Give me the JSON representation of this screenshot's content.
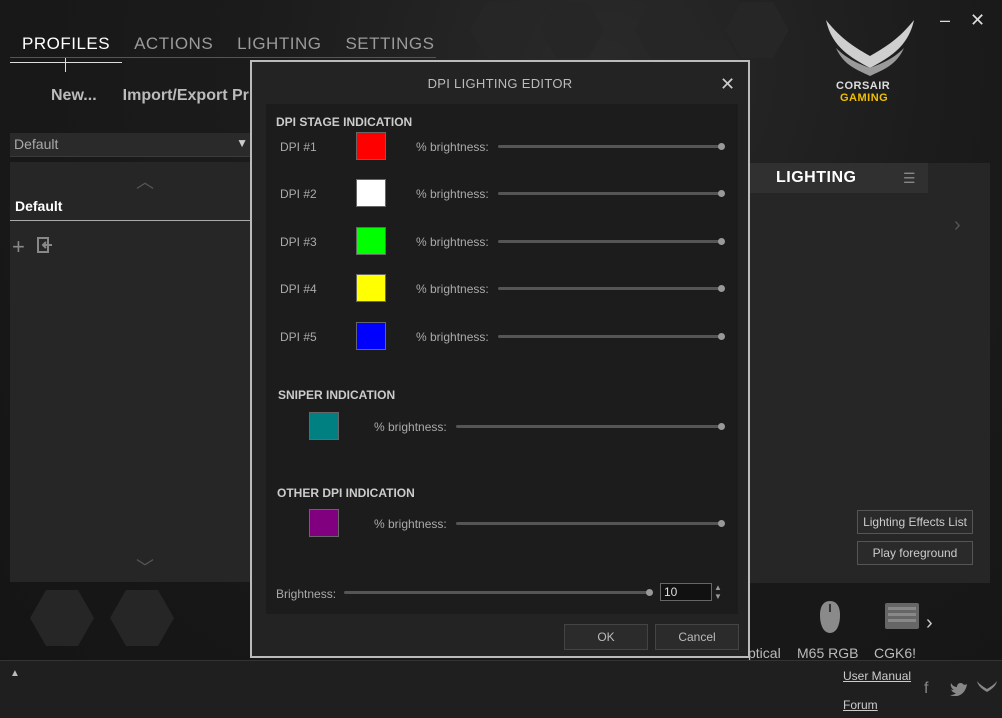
{
  "nav": {
    "tabs": [
      {
        "label": "PROFILES",
        "active": true
      },
      {
        "label": "ACTIONS",
        "active": false
      },
      {
        "label": "LIGHTING",
        "active": false
      },
      {
        "label": "SETTINGS",
        "active": false
      }
    ]
  },
  "window": {
    "minimize": "–",
    "close": "✕"
  },
  "logo": {
    "line1": "CORSAIR",
    "line2": "GAMING"
  },
  "profiles": {
    "new_label": "New...",
    "import_export_label": "Import/Export Pr",
    "selected": "Default",
    "items": [
      "Default"
    ]
  },
  "right_panel": {
    "tab_label": "LIGHTING",
    "effects_list_label": "Lighting Effects List",
    "play_label": "Play foreground"
  },
  "devices": [
    "ptical",
    "M65 RGB",
    "CGK6!"
  ],
  "bottom": {
    "user_manual": "User Manual",
    "forum": "Forum"
  },
  "dialog": {
    "title": "DPI LIGHTING EDITOR",
    "stage_section": "DPI STAGE INDICATION",
    "brightness_label": "% brightness:",
    "stages": [
      {
        "label": "DPI #1",
        "color": "#ff0000"
      },
      {
        "label": "DPI #2",
        "color": "#ffffff"
      },
      {
        "label": "DPI #3",
        "color": "#00ff00"
      },
      {
        "label": "DPI #4",
        "color": "#ffff00"
      },
      {
        "label": "DPI #5",
        "color": "#0000ff"
      }
    ],
    "sniper_section": "SNIPER INDICATION",
    "sniper_color": "#008080",
    "other_section": "OTHER DPI INDICATION",
    "other_color": "#800080",
    "master_brightness_label": "Brightness:",
    "master_brightness_value": "10",
    "ok_label": "OK",
    "cancel_label": "Cancel"
  }
}
